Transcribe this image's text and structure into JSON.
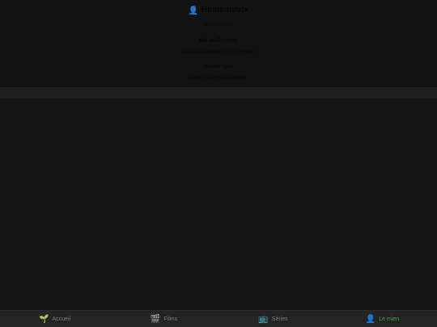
{
  "profile": {
    "user_icon": "user-icon",
    "name": "Homemovix",
    "subtitle": "Se connecter",
    "collection_heading": "Ma collection",
    "collection_text": "Aucune collection pour le moment",
    "history_heading": "Historique",
    "history_text": "Aucun historique disponible"
  },
  "tabbar": {
    "tabs": [
      {
        "label": "Accueil",
        "icon": "sprout-icon",
        "glyph": "🌱"
      },
      {
        "label": "Films",
        "icon": "clapper-icon",
        "glyph": "🎬"
      },
      {
        "label": "Séries",
        "icon": "tv-icon",
        "glyph": "📺"
      },
      {
        "label": "Le mien",
        "icon": "user-icon",
        "glyph": "👤"
      }
    ],
    "active_color": "#39a835",
    "inactive_color": "#7c7c7c"
  }
}
